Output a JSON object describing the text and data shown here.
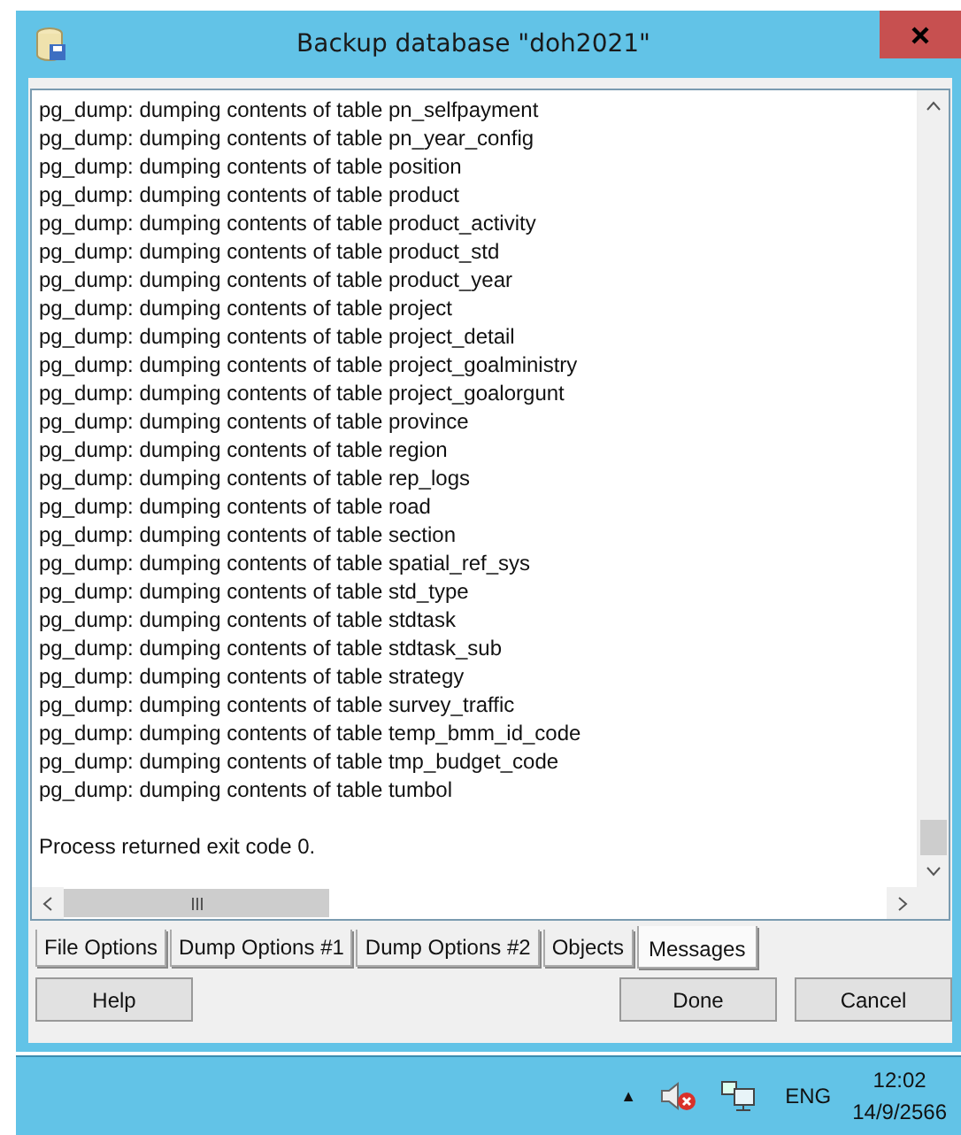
{
  "window": {
    "title": "Backup database \"doh2021\""
  },
  "log": {
    "lines": [
      "pg_dump: dumping contents of table pn_selfpayment",
      "pg_dump: dumping contents of table pn_year_config",
      "pg_dump: dumping contents of table position",
      "pg_dump: dumping contents of table product",
      "pg_dump: dumping contents of table product_activity",
      "pg_dump: dumping contents of table product_std",
      "pg_dump: dumping contents of table product_year",
      "pg_dump: dumping contents of table project",
      "pg_dump: dumping contents of table project_detail",
      "pg_dump: dumping contents of table project_goalministry",
      "pg_dump: dumping contents of table project_goalorgunt",
      "pg_dump: dumping contents of table province",
      "pg_dump: dumping contents of table region",
      "pg_dump: dumping contents of table rep_logs",
      "pg_dump: dumping contents of table road",
      "pg_dump: dumping contents of table section",
      "pg_dump: dumping contents of table spatial_ref_sys",
      "pg_dump: dumping contents of table std_type",
      "pg_dump: dumping contents of table stdtask",
      "pg_dump: dumping contents of table stdtask_sub",
      "pg_dump: dumping contents of table strategy",
      "pg_dump: dumping contents of table survey_traffic",
      "pg_dump: dumping contents of table temp_bmm_id_code",
      "pg_dump: dumping contents of table tmp_budget_code",
      "pg_dump: dumping contents of table tumbol"
    ],
    "result": "Process returned exit code 0."
  },
  "tabs": [
    {
      "label": "File Options",
      "selected": false
    },
    {
      "label": "Dump Options #1",
      "selected": false
    },
    {
      "label": "Dump Options #2",
      "selected": false
    },
    {
      "label": "Objects",
      "selected": false
    },
    {
      "label": "Messages",
      "selected": true
    }
  ],
  "buttons": {
    "left": [
      "Help"
    ],
    "right": [
      "Done",
      "Cancel"
    ]
  },
  "taskbar": {
    "tray_arrow": "▲",
    "language": "ENG",
    "time": "12:02",
    "date": "14/9/2566"
  }
}
